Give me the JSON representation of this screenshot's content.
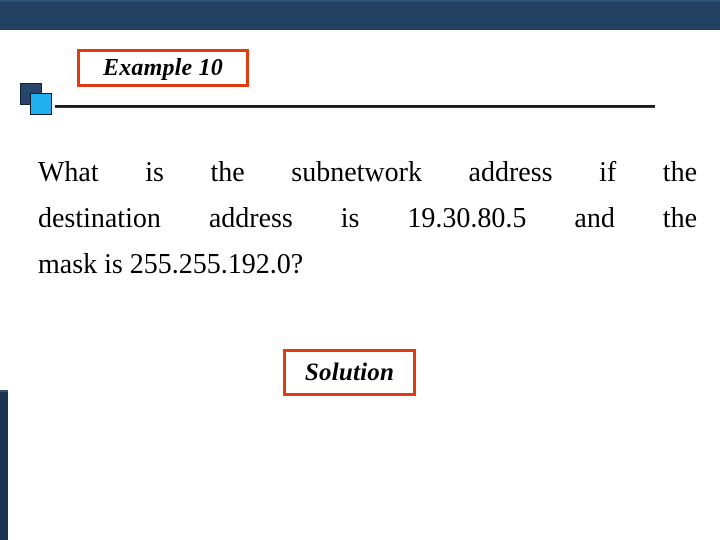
{
  "slide": {
    "title": "Example 10",
    "solution_label": "Solution",
    "body_lines": [
      "What is the subnetwork address if the",
      "destination address is 19.30.80.5 and the",
      "mask is 255.255.192.0?"
    ],
    "body_words": {
      "line1": [
        "What",
        "is",
        "the",
        "subnetwork",
        "address",
        "if",
        "the"
      ],
      "line2": [
        "destination",
        "address",
        "is",
        "19.30.80.5",
        "and",
        "the"
      ],
      "line3": [
        "mask is 255.255.192.0?"
      ]
    },
    "question_text": "What is the subnetwork address if the destination address is 19.30.80.5 and the mask is 255.255.192.0?",
    "destination_address": "19.30.80.5",
    "subnet_mask": "255.255.192.0",
    "colors": {
      "banner": "#22405f",
      "accent_border": "#e03c10",
      "square_back": "#27456a",
      "square_front": "#20b0f0",
      "rule": "#1c1a16",
      "text": "#000000",
      "background": "#ffffff"
    }
  }
}
